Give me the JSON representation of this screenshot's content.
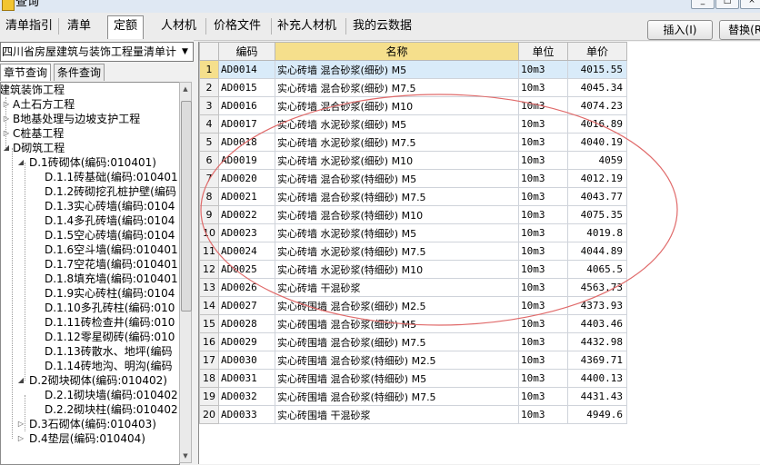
{
  "window": {
    "title": "查询"
  },
  "tabs": [
    {
      "label": "清单指引"
    },
    {
      "label": "清单"
    },
    {
      "label": "定额"
    },
    {
      "label": "人材机"
    },
    {
      "label": "价格文件"
    },
    {
      "label": "补充人材机"
    },
    {
      "label": "我的云数据"
    }
  ],
  "toolbar": {
    "insert_label": "插入(I)",
    "replace_label": "替换(R)"
  },
  "library": {
    "selected": "四川省房屋建筑与装饰工程量清单计"
  },
  "left_tabs": [
    {
      "label": "章节查询"
    },
    {
      "label": "条件查询"
    }
  ],
  "tree": [
    {
      "text": "建筑装饰工程",
      "toggle": ""
    },
    {
      "text": "A土石方工程",
      "toggle": "▷"
    },
    {
      "text": "B地基处理与边坡支护工程",
      "toggle": "▷"
    },
    {
      "text": "C桩基工程",
      "toggle": "▷"
    },
    {
      "text": "D砌筑工程",
      "toggle": "◢"
    },
    {
      "text": "D.1砖砌体(编码:010401)",
      "toggle": "◢"
    },
    {
      "text": "D.1.1砖基础(编码:010401",
      "toggle": ""
    },
    {
      "text": "D.1.2砖砌挖孔桩护壁(编码",
      "toggle": ""
    },
    {
      "text": "D.1.3实心砖墙(编码:0104",
      "toggle": ""
    },
    {
      "text": "D.1.4多孔砖墙(编码:0104",
      "toggle": ""
    },
    {
      "text": "D.1.5空心砖墙(编码:0104",
      "toggle": ""
    },
    {
      "text": "D.1.6空斗墙(编码:010401",
      "toggle": ""
    },
    {
      "text": "D.1.7空花墙(编码:010401",
      "toggle": ""
    },
    {
      "text": "D.1.8填充墙(编码:010401",
      "toggle": ""
    },
    {
      "text": "D.1.9实心砖柱(编码:0104",
      "toggle": ""
    },
    {
      "text": "D.1.10多孔砖柱(编码:010",
      "toggle": ""
    },
    {
      "text": "D.1.11砖检查井(编码:010",
      "toggle": ""
    },
    {
      "text": "D.1.12零星砌砖(编码:010",
      "toggle": ""
    },
    {
      "text": "D.1.13砖散水、地坪(编码",
      "toggle": ""
    },
    {
      "text": "D.1.14砖地沟、明沟(编码",
      "toggle": ""
    },
    {
      "text": "D.2砌块砌体(编码:010402)",
      "toggle": "◢"
    },
    {
      "text": "D.2.1砌块墙(编码:010402",
      "toggle": ""
    },
    {
      "text": "D.2.2砌块柱(编码:010402",
      "toggle": ""
    },
    {
      "text": "D.3石砌体(编码:010403)",
      "toggle": "▷"
    },
    {
      "text": "D.4垫层(编码:010404)",
      "toggle": "▷"
    }
  ],
  "grid": {
    "columns": [
      "",
      "编码",
      "名称",
      "单位",
      "单价"
    ],
    "rows": [
      {
        "n": "1",
        "code": "AD0014",
        "name": "实心砖墙 混合砂浆(细砂) M5",
        "unit": "10m3",
        "price": "4015.55"
      },
      {
        "n": "2",
        "code": "AD0015",
        "name": "实心砖墙 混合砂浆(细砂) M7.5",
        "unit": "10m3",
        "price": "4045.34"
      },
      {
        "n": "3",
        "code": "AD0016",
        "name": "实心砖墙 混合砂浆(细砂) M10",
        "unit": "10m3",
        "price": "4074.23"
      },
      {
        "n": "4",
        "code": "AD0017",
        "name": "实心砖墙 水泥砂浆(细砂) M5",
        "unit": "10m3",
        "price": "4016.89"
      },
      {
        "n": "5",
        "code": "AD0018",
        "name": "实心砖墙 水泥砂浆(细砂) M7.5",
        "unit": "10m3",
        "price": "4040.19"
      },
      {
        "n": "6",
        "code": "AD0019",
        "name": "实心砖墙 水泥砂浆(细砂) M10",
        "unit": "10m3",
        "price": "4059"
      },
      {
        "n": "7",
        "code": "AD0020",
        "name": "实心砖墙 混合砂浆(特细砂) M5",
        "unit": "10m3",
        "price": "4012.19"
      },
      {
        "n": "8",
        "code": "AD0021",
        "name": "实心砖墙 混合砂浆(特细砂) M7.5",
        "unit": "10m3",
        "price": "4043.77"
      },
      {
        "n": "9",
        "code": "AD0022",
        "name": "实心砖墙 混合砂浆(特细砂) M10",
        "unit": "10m3",
        "price": "4075.35"
      },
      {
        "n": "10",
        "code": "AD0023",
        "name": "实心砖墙 水泥砂浆(特细砂) M5",
        "unit": "10m3",
        "price": "4019.8"
      },
      {
        "n": "11",
        "code": "AD0024",
        "name": "实心砖墙 水泥砂浆(特细砂) M7.5",
        "unit": "10m3",
        "price": "4044.89"
      },
      {
        "n": "12",
        "code": "AD0025",
        "name": "实心砖墙 水泥砂浆(特细砂) M10",
        "unit": "10m3",
        "price": "4065.5"
      },
      {
        "n": "13",
        "code": "AD0026",
        "name": "实心砖墙 干混砂浆",
        "unit": "10m3",
        "price": "4563.73"
      },
      {
        "n": "14",
        "code": "AD0027",
        "name": "实心砖围墙 混合砂浆(细砂) M2.5",
        "unit": "10m3",
        "price": "4373.93"
      },
      {
        "n": "15",
        "code": "AD0028",
        "name": "实心砖围墙 混合砂浆(细砂) M5",
        "unit": "10m3",
        "price": "4403.46"
      },
      {
        "n": "16",
        "code": "AD0029",
        "name": "实心砖围墙 混合砂浆(细砂) M7.5",
        "unit": "10m3",
        "price": "4432.98"
      },
      {
        "n": "17",
        "code": "AD0030",
        "name": "实心砖围墙 混合砂浆(特细砂) M2.5",
        "unit": "10m3",
        "price": "4369.71"
      },
      {
        "n": "18",
        "code": "AD0031",
        "name": "实心砖围墙 混合砂浆(特细砂) M5",
        "unit": "10m3",
        "price": "4400.13"
      },
      {
        "n": "19",
        "code": "AD0032",
        "name": "实心砖围墙 混合砂浆(特细砂) M7.5",
        "unit": "10m3",
        "price": "4431.43"
      },
      {
        "n": "20",
        "code": "AD0033",
        "name": "实心砖围墙 干混砂浆",
        "unit": "10m3",
        "price": "4949.6"
      }
    ]
  },
  "colors": {
    "selection": "#d9ebf9",
    "header_highlight": "#f5df8c",
    "annotation": "#e06a6a"
  }
}
